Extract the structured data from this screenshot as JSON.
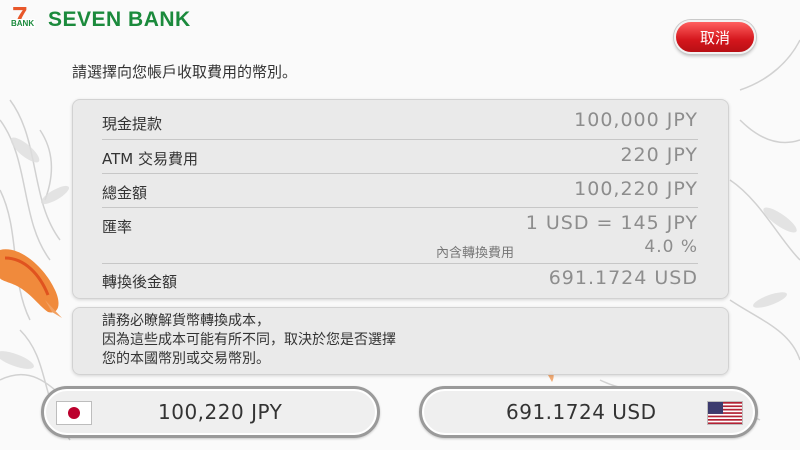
{
  "brand": {
    "logo_mark": "7",
    "logo_small": "BANK",
    "name": "SEVEN BANK"
  },
  "header": {
    "cancel_label": "取消"
  },
  "instruction": "請選擇向您帳戶收取費用的幣別。",
  "summary": {
    "rows": [
      {
        "label": "現金提款",
        "value": "100,000 JPY"
      },
      {
        "label": "ATM 交易費用",
        "value": "220 JPY"
      },
      {
        "label": "總金額",
        "value": "100,220 JPY"
      },
      {
        "label": "匯率",
        "value": "1 USD = 145 JPY",
        "sub_label": "內含轉換費用",
        "sub_value": "4.0 %"
      },
      {
        "label": "轉換後金額",
        "value": "691.1724 USD"
      }
    ]
  },
  "note": {
    "lines": [
      "請務必瞭解貨幣轉換成本，",
      "因為這些成本可能有所不同，取決於您是否選擇",
      "您的本國幣別或交易幣別。"
    ]
  },
  "choices": {
    "jpy": {
      "amount": "100,220 JPY",
      "flag_icon": "japan-flag-icon"
    },
    "usd": {
      "amount": "691.1724 USD",
      "flag_icon": "usa-flag-icon"
    }
  },
  "colors": {
    "brand_green": "#1b8a3c",
    "brand_orange": "#e8572a",
    "cancel_red": "#d4161c",
    "value_gray": "#8d8d8d"
  }
}
